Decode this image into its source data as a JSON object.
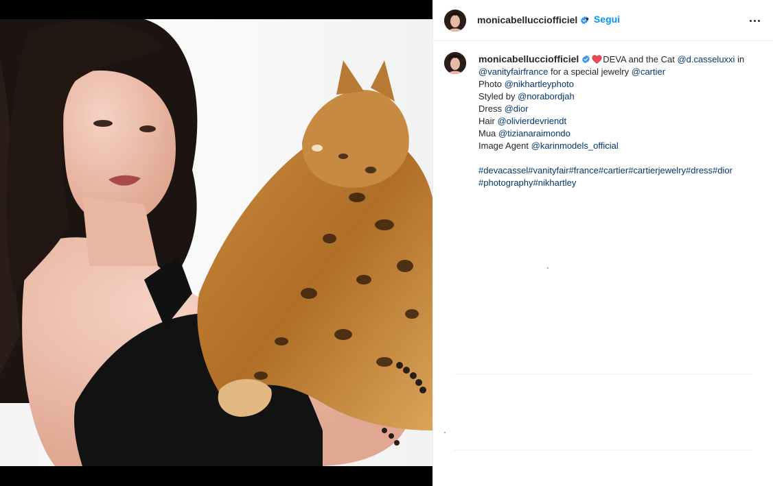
{
  "post": {
    "username": "monicabellucciofficiel",
    "verified": true,
    "separator": "•",
    "follow_label": "Segui",
    "more_icon": "more-horizontal-icon"
  },
  "caption": {
    "username": "monicabellucciofficiel",
    "line1_text": "DEVA and the Cat ",
    "line1_mention": "@d.casseluxxi",
    "line1_tail": " in",
    "line2_mention1": "@vanityfairfrance",
    "line2_text": " for a special jewelry ",
    "line2_mention2": "@cartier",
    "photo_label": "Photo ",
    "photo_mention": "@nikhartleyphoto",
    "styled_label": "Styled by ",
    "styled_mention": "@norabordjah",
    "dress_label": "Dress ",
    "dress_mention": "@dior",
    "hair_label": "Hair ",
    "hair_mention": "@olivierdevriendt",
    "mua_label": "Mua ",
    "mua_mention": "@tizianaraimondo",
    "agent_label": "Image Agent ",
    "agent_mention": "@karinmodels_official",
    "hashtags_line1": "#devacassel#vanityfair#france#cartier#cartierjewelry#dress#dior",
    "hashtags_line2": "#photography#nikhartley"
  },
  "colors": {
    "link": "#00376b",
    "follow": "#0095f6",
    "verified": "#3897f0",
    "heart": "#ed4956"
  }
}
